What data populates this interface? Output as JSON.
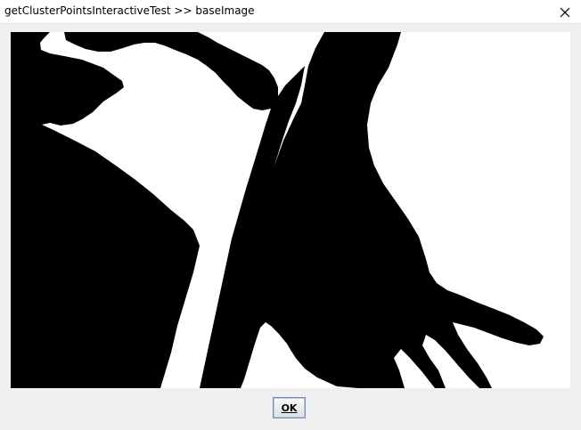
{
  "window": {
    "title": "getClusterPointsInteractiveTest >> baseImage"
  },
  "image": {
    "icon": "binary-hands-image",
    "background_color": "#ffffff",
    "foreground_color": "#000000"
  },
  "buttons": {
    "ok_label": "OK"
  },
  "colors": {
    "window_bg": "#f0f0f0",
    "titlebar_bg": "#ffffff"
  }
}
